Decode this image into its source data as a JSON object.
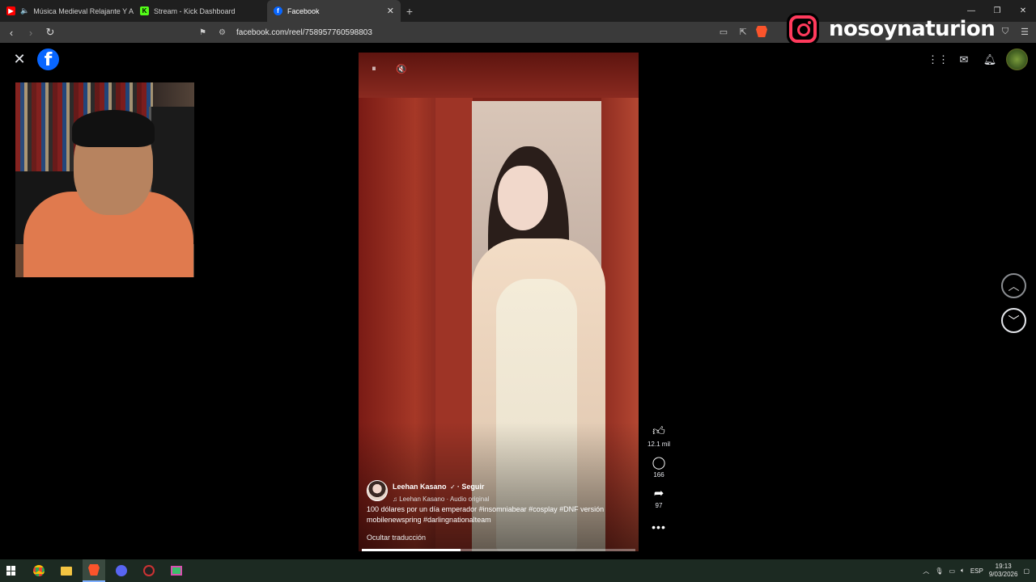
{
  "browser": {
    "tabs": [
      {
        "title": "Música Medieval Relajante Y Acc",
        "favicon_color": "#ff0000",
        "active": false
      },
      {
        "title": "Stream - Kick Dashboard",
        "favicon_color": "#53fc18",
        "favicon_text": "K",
        "active": false
      },
      {
        "title": "Facebook",
        "favicon_color": "#0866ff",
        "favicon_text": "f",
        "active": true
      }
    ],
    "url": "facebook.com/reel/758957760598803"
  },
  "overlay": {
    "instagram_handle": "nosoynaturion"
  },
  "facebook": {
    "logo_letter": "f"
  },
  "reel": {
    "author": "Leehan Kasano",
    "follow": "· Seguir",
    "audio": "Leehan Kasano · Audio original",
    "caption": "100 dólares por un día emperador #insomniabear #cosplay #DNF versión mobilenewspring #darlingnationalteam",
    "hide_translation": "Ocultar traducción",
    "progress": 0.36,
    "likes": "12.1 mil",
    "comments": "166",
    "shares": "97"
  },
  "taskbar": {
    "language": "ESP",
    "time": "19:13",
    "date": "9/03/2026"
  }
}
